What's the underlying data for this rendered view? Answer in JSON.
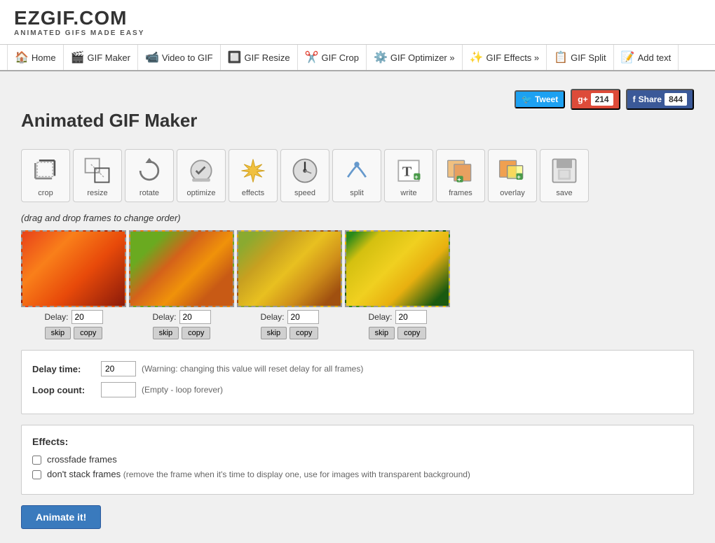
{
  "logo": {
    "text": "EZGIF.COM",
    "subtitle": "ANIMATED GIFS MADE EASY"
  },
  "nav": {
    "items": [
      {
        "label": "Home",
        "icon": "🏠",
        "name": "home"
      },
      {
        "label": "GIF Maker",
        "icon": "🎬",
        "name": "gif-maker"
      },
      {
        "label": "Video to GIF",
        "icon": "📹",
        "name": "video-to-gif"
      },
      {
        "label": "GIF Resize",
        "icon": "🔲",
        "name": "gif-resize"
      },
      {
        "label": "GIF Crop",
        "icon": "✂️",
        "name": "gif-crop"
      },
      {
        "label": "GIF Optimizer »",
        "icon": "⚙️",
        "name": "gif-optimizer"
      },
      {
        "label": "GIF Effects »",
        "icon": "✨",
        "name": "gif-effects"
      },
      {
        "label": "GIF Split",
        "icon": "📋",
        "name": "gif-split"
      },
      {
        "label": "Add text",
        "icon": "📝",
        "name": "add-text"
      }
    ]
  },
  "social": {
    "tweet_label": "Tweet",
    "gplus_count": "214",
    "share_label": "Share",
    "share_count": "844"
  },
  "page": {
    "title": "Animated GIF Maker"
  },
  "tools": [
    {
      "label": "crop",
      "name": "crop-tool"
    },
    {
      "label": "resize",
      "name": "resize-tool"
    },
    {
      "label": "rotate",
      "name": "rotate-tool"
    },
    {
      "label": "optimize",
      "name": "optimize-tool"
    },
    {
      "label": "effects",
      "name": "effects-tool"
    },
    {
      "label": "speed",
      "name": "speed-tool"
    },
    {
      "label": "split",
      "name": "split-tool"
    },
    {
      "label": "write",
      "name": "write-tool"
    },
    {
      "label": "frames",
      "name": "frames-tool"
    },
    {
      "label": "overlay",
      "name": "overlay-tool"
    },
    {
      "label": "save",
      "name": "save-tool"
    }
  ],
  "drag_hint": "(drag and drop frames to change order)",
  "frames": [
    {
      "delay": "20",
      "skip_label": "skip",
      "copy_label": "copy"
    },
    {
      "delay": "20",
      "skip_label": "skip",
      "copy_label": "copy"
    },
    {
      "delay": "20",
      "skip_label": "skip",
      "copy_label": "copy"
    },
    {
      "delay": "20",
      "skip_label": "skip",
      "copy_label": "copy"
    }
  ],
  "settings": {
    "delay_label": "Delay time:",
    "delay_value": "20",
    "delay_hint": "(Warning: changing this value will reset delay for all frames)",
    "loop_label": "Loop count:",
    "loop_value": "",
    "loop_hint": "(Empty - loop forever)"
  },
  "effects": {
    "title": "Effects:",
    "crossfade_label": "crossfade frames",
    "nostack_label": "don't stack frames",
    "nostack_hint": "(remove the frame when it's time to display one, use for images with transparent background)"
  },
  "animate_button": "Animate it!"
}
